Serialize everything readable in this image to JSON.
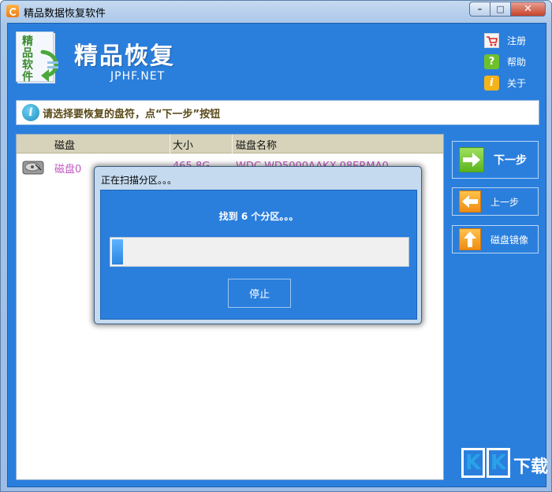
{
  "window": {
    "title": "精品数据恢复软件",
    "controls": {
      "minimize": "–",
      "maximize": "□",
      "close": "✕"
    }
  },
  "header": {
    "logo_text": "精品软件",
    "title": "精品恢复",
    "subtitle": "JPHF.NET",
    "links": [
      {
        "label": "注册",
        "icon": "cart-icon"
      },
      {
        "label": "帮助",
        "icon": "help-icon"
      },
      {
        "label": "关于",
        "icon": "info-icon"
      }
    ]
  },
  "instruction": "请选择要恢复的盘符，点“下一步”按钮",
  "disk_list": {
    "columns": [
      "磁盘",
      "大小",
      "磁盘名称"
    ],
    "rows": [
      {
        "disk": "磁盘0",
        "size": "465.8G",
        "name": "WDC WD5000AAKX-08ERMA0"
      }
    ]
  },
  "buttons": {
    "next": "下一步",
    "prev": "上一步",
    "disk_image": "磁盘镜像"
  },
  "dialog": {
    "title": "正在扫描分区。。。",
    "message": "找到 6 个分区。。。",
    "progress": 0.03,
    "stop": "停止"
  },
  "watermark": {
    "text": "下载",
    "letters": [
      "K",
      "K"
    ]
  },
  "colors": {
    "accent": "#2a7fdd",
    "highlight": "#c058c0",
    "header_bg": "#d6d3ba"
  }
}
